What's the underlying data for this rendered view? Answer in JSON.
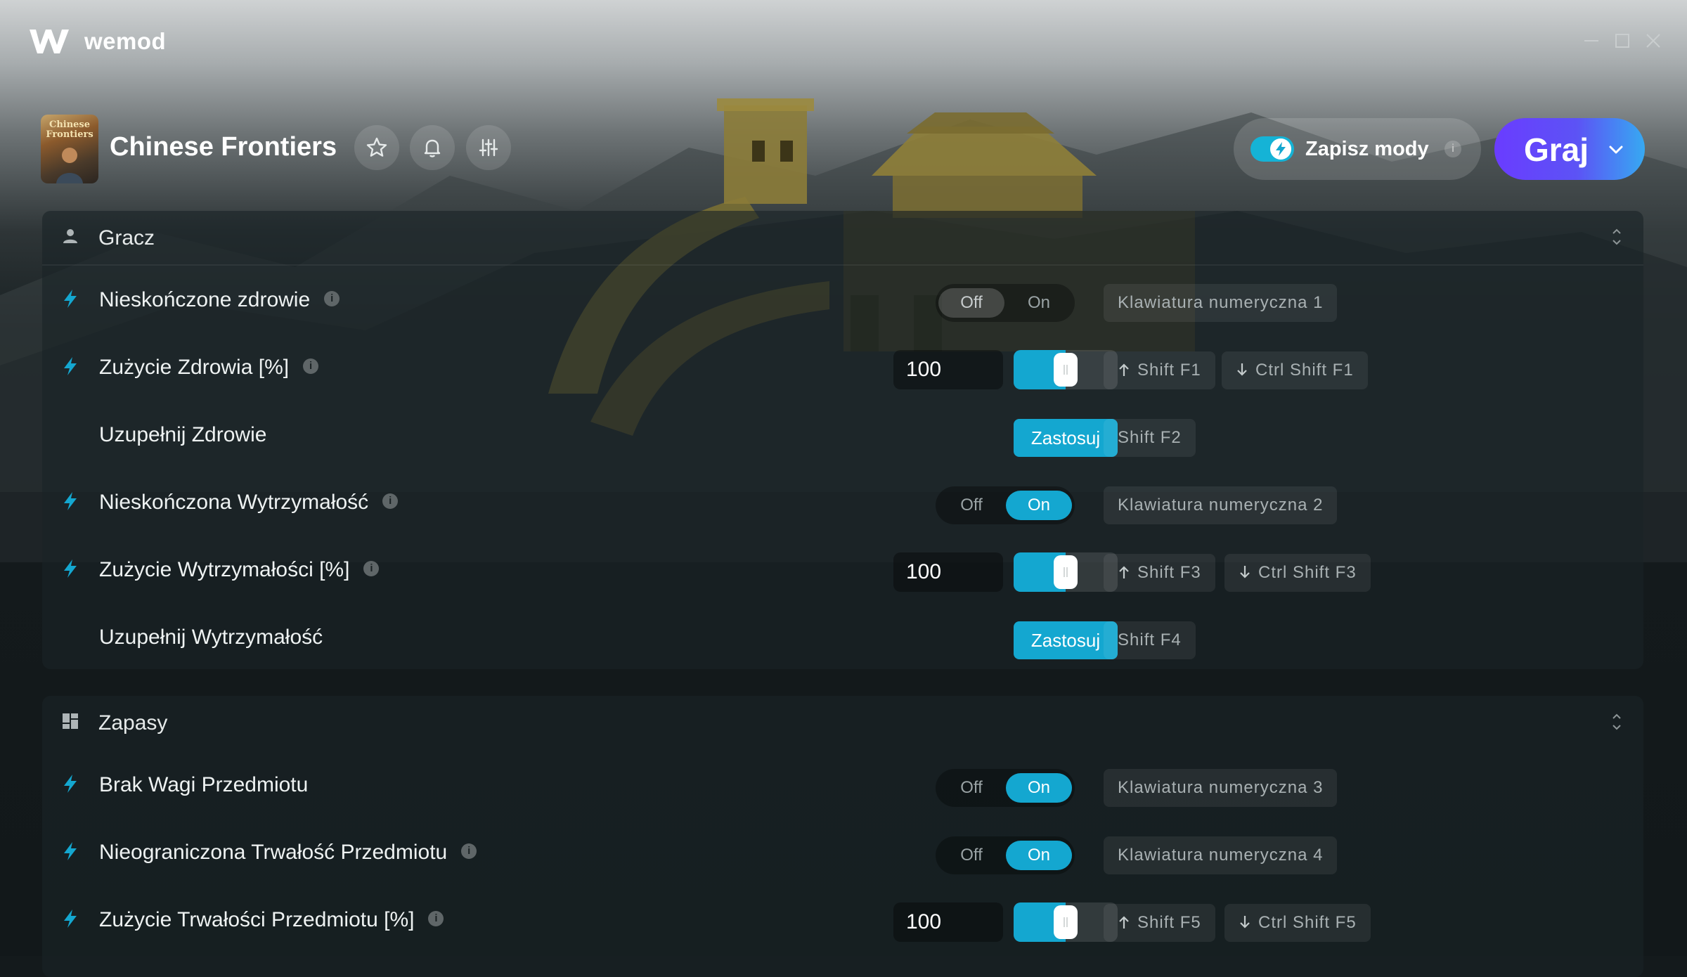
{
  "app": {
    "name": "wemod"
  },
  "game": {
    "title": "Chinese Frontiers",
    "cover_text": "Chinese Frontiers",
    "save_mods_label": "Zapisz mody",
    "save_mods_enabled": true,
    "save_info": "i",
    "play_label": "Graj"
  },
  "sections": [
    {
      "title": "Gracz",
      "icon": "user-icon",
      "rows": [
        {
          "label": "Nieskończone zdrowie",
          "info": true,
          "type": "toggle",
          "off": "Off",
          "on": "On",
          "state": "Off",
          "hotkeys": [
            "Klawiatura numeryczna 1"
          ]
        },
        {
          "label": "Zużycie Zdrowia [%]",
          "info": true,
          "type": "slider",
          "value": "100",
          "slider_level": 0.5,
          "hotkeys": [
            "Shift F1",
            "Ctrl Shift F1"
          ]
        },
        {
          "label": "Uzupełnij Zdrowie",
          "info": false,
          "type": "apply",
          "button": "Zastosuj",
          "hotkeys": [
            "Shift F2"
          ]
        },
        {
          "label": "Nieskończona Wytrzymałość",
          "info": true,
          "type": "toggle",
          "off": "Off",
          "on": "On",
          "state": "On",
          "hotkeys": [
            "Klawiatura numeryczna 2"
          ]
        },
        {
          "label": "Zużycie Wytrzymałości [%]",
          "info": true,
          "type": "slider",
          "value": "100",
          "slider_level": 0.5,
          "hotkeys": [
            "Shift F3",
            "Ctrl Shift F3"
          ]
        },
        {
          "label": "Uzupełnij Wytrzymałość",
          "info": false,
          "type": "apply",
          "button": "Zastosuj",
          "hotkeys": [
            "Shift F4"
          ]
        }
      ]
    },
    {
      "title": "Zapasy",
      "icon": "dashboard-icon",
      "rows": [
        {
          "label": "Brak Wagi Przedmiotu",
          "info": false,
          "type": "toggle",
          "off": "Off",
          "on": "On",
          "state": "On",
          "hotkeys": [
            "Klawiatura numeryczna 3"
          ]
        },
        {
          "label": "Nieograniczona Trwałość Przedmiotu",
          "info": true,
          "type": "toggle",
          "off": "Off",
          "on": "On",
          "state": "On",
          "hotkeys": [
            "Klawiatura numeryczna 4"
          ]
        },
        {
          "label": "Zużycie Trwałości Przedmiotu [%]",
          "info": true,
          "type": "slider",
          "value": "100",
          "slider_level": 0.5,
          "hotkeys": [
            "Shift F5",
            "Ctrl Shift F5"
          ]
        }
      ]
    }
  ],
  "colors": {
    "accent": "#14a7d0",
    "play_start": "#6a3cff",
    "play_end": "#37a9f2"
  }
}
